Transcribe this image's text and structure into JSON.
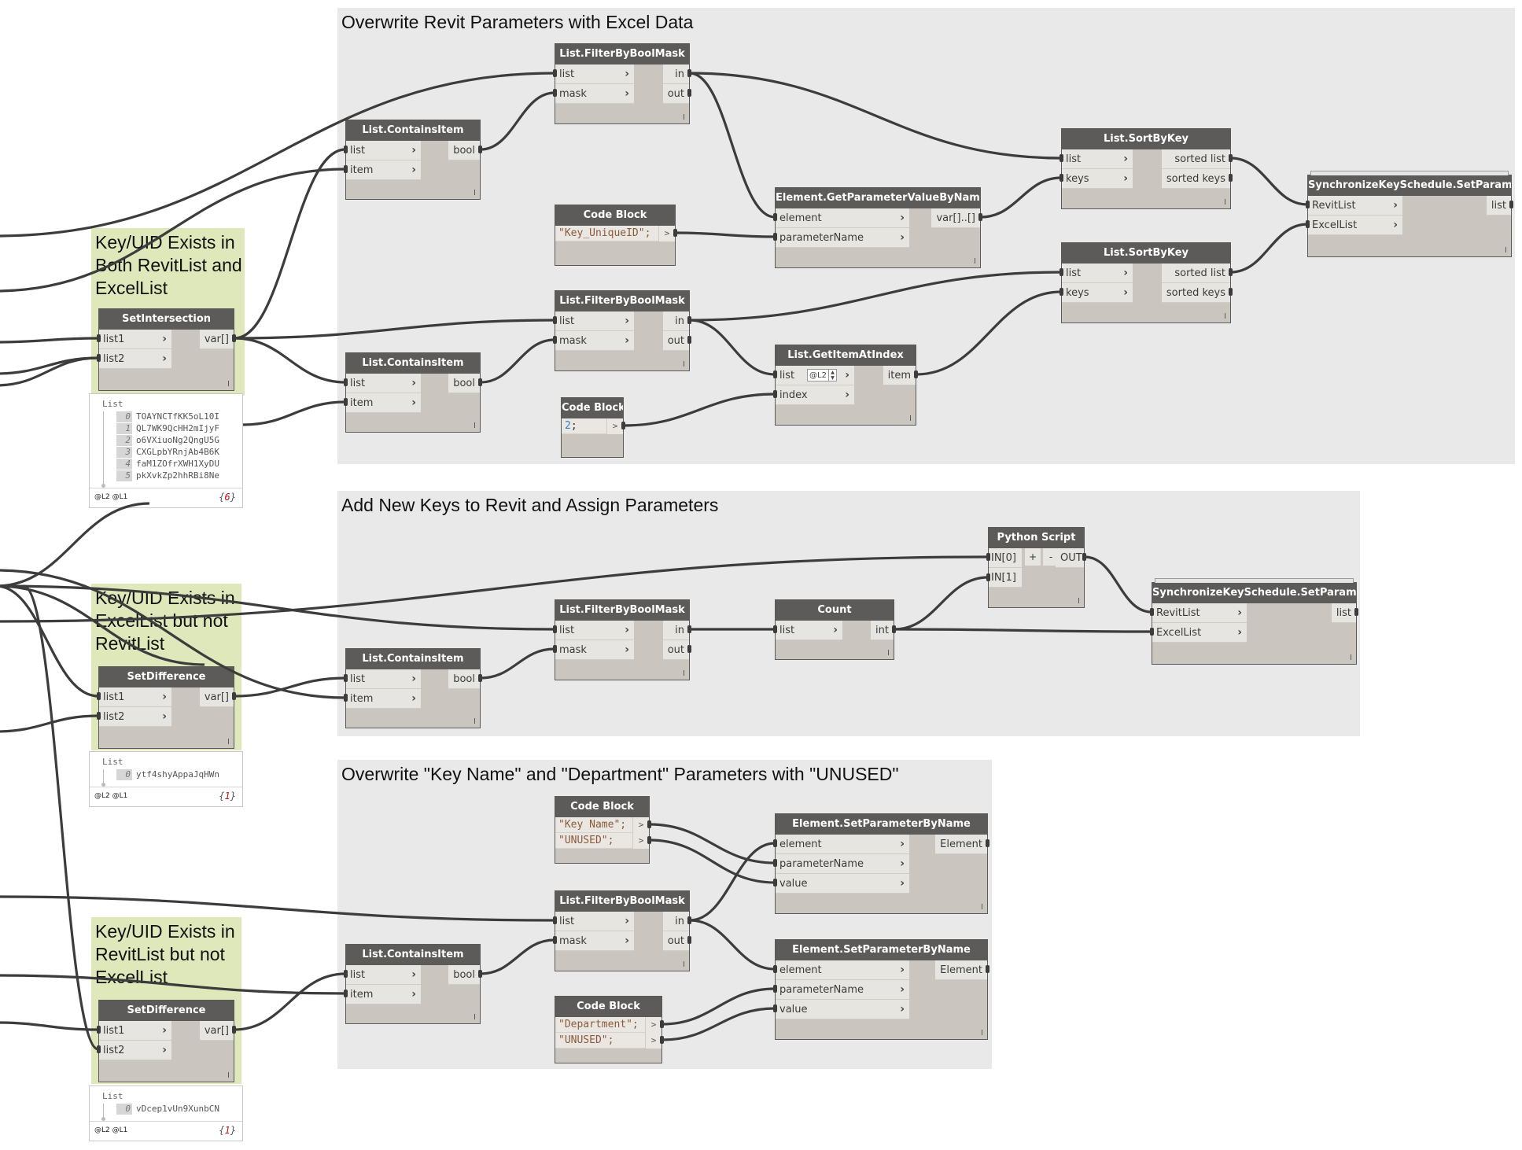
{
  "groups": [
    {
      "id": "g1",
      "title": "Overwrite Revit Parameters with Excel Data"
    },
    {
      "id": "g2",
      "title": "Add New Keys to Revit and Assign Parameters"
    },
    {
      "id": "g3",
      "title": "Overwrite \"Key Name\" and \"Department\" Parameters with \"UNUSED\""
    },
    {
      "id": "gA",
      "title": "Key/UID Exists in Both RevitList and ExcelList"
    },
    {
      "id": "gB",
      "title": "Key/UID Exists in ExcelList but not RevitList"
    },
    {
      "id": "gC",
      "title": "Key/UID Exists in RevitList but not ExcelList"
    }
  ],
  "nodes": {
    "setIntersection": {
      "title": "SetIntersection",
      "inputs": [
        "list1",
        "list2"
      ],
      "outputs": [
        "var[]"
      ]
    },
    "setDifferenceB": {
      "title": "SetDifference",
      "inputs": [
        "list1",
        "list2"
      ],
      "outputs": [
        "var[]"
      ]
    },
    "setDifferenceC": {
      "title": "SetDifference",
      "inputs": [
        "list1",
        "list2"
      ],
      "outputs": [
        "var[]"
      ]
    },
    "g1_filter1": {
      "title": "List.FilterByBoolMask",
      "inputs": [
        "list",
        "mask"
      ],
      "outputs": [
        "in",
        "out"
      ]
    },
    "g1_contains1": {
      "title": "List.ContainsItem",
      "inputs": [
        "list",
        "item"
      ],
      "outputs": [
        "bool"
      ]
    },
    "g1_code1": {
      "title": "Code Block",
      "lines": [
        "\"Key_UniqueID\";"
      ]
    },
    "g1_getparam": {
      "title": "Element.GetParameterValueByName",
      "inputs": [
        "element",
        "parameterName"
      ],
      "outputs": [
        "var[]..[]"
      ]
    },
    "g1_sort1": {
      "title": "List.SortByKey",
      "inputs": [
        "list",
        "keys"
      ],
      "outputs": [
        "sorted list",
        "sorted keys"
      ]
    },
    "g1_sync": {
      "title": "SynchronizeKeySchedule.SetParameters",
      "inputs": [
        "RevitList",
        "ExcelList"
      ],
      "outputs": [
        "list"
      ]
    },
    "g1_filter2": {
      "title": "List.FilterByBoolMask",
      "inputs": [
        "list",
        "mask"
      ],
      "outputs": [
        "in",
        "out"
      ]
    },
    "g1_contains2": {
      "title": "List.ContainsItem",
      "inputs": [
        "list",
        "item"
      ],
      "outputs": [
        "bool"
      ]
    },
    "g1_code2": {
      "title": "Code Block",
      "lines": [
        "2;"
      ]
    },
    "g1_getitem": {
      "title": "List.GetItemAtIndex",
      "inputs": [
        "list",
        "index"
      ],
      "outputs": [
        "item"
      ],
      "level": "@L2"
    },
    "g1_sort2": {
      "title": "List.SortByKey",
      "inputs": [
        "list",
        "keys"
      ],
      "outputs": [
        "sorted list",
        "sorted keys"
      ]
    },
    "g2_python": {
      "title": "Python Script",
      "inputs": [
        "IN[0]",
        "IN[1]"
      ],
      "outputs": [
        "OUT"
      ],
      "add": "+",
      "remove": "-"
    },
    "g2_filter": {
      "title": "List.FilterByBoolMask",
      "inputs": [
        "list",
        "mask"
      ],
      "outputs": [
        "in",
        "out"
      ]
    },
    "g2_contains": {
      "title": "List.ContainsItem",
      "inputs": [
        "list",
        "item"
      ],
      "outputs": [
        "bool"
      ]
    },
    "g2_count": {
      "title": "Count",
      "inputs": [
        "list"
      ],
      "outputs": [
        "int"
      ]
    },
    "g2_sync": {
      "title": "SynchronizeKeySchedule.SetParameters",
      "inputs": [
        "RevitList",
        "ExcelList"
      ],
      "outputs": [
        "list"
      ]
    },
    "g3_code1": {
      "title": "Code Block",
      "lines": [
        "\"Key Name\";",
        "\"UNUSED\";"
      ]
    },
    "g3_setparam1": {
      "title": "Element.SetParameterByName",
      "inputs": [
        "element",
        "parameterName",
        "value"
      ],
      "outputs": [
        "Element"
      ]
    },
    "g3_filter": {
      "title": "List.FilterByBoolMask",
      "inputs": [
        "list",
        "mask"
      ],
      "outputs": [
        "in",
        "out"
      ]
    },
    "g3_contains": {
      "title": "List.ContainsItem",
      "inputs": [
        "list",
        "item"
      ],
      "outputs": [
        "bool"
      ]
    },
    "g3_setparam2": {
      "title": "Element.SetParameterByName",
      "inputs": [
        "element",
        "parameterName",
        "value"
      ],
      "outputs": [
        "Element"
      ]
    },
    "g3_code2": {
      "title": "Code Block",
      "lines": [
        "\"Department\";",
        "\"UNUSED\";"
      ]
    }
  },
  "watches": {
    "wA": {
      "title": "List",
      "items": [
        "TOAYNCTfKK5oL10I",
        "QL7WK9QcHH2mIjyF",
        "o6VXiuoNg2QngU5G",
        "CXGLpbYRnjAb4B6K",
        "faM1ZOfrXWH1XyDU",
        "pkXvkZp2hhRBi8Ne"
      ],
      "levels": "@L2 @L1",
      "count": "6"
    },
    "wB": {
      "title": "List",
      "items": [
        "ytf4shyAppaJqHWn"
      ],
      "levels": "@L2 @L1",
      "count": "1"
    },
    "wC": {
      "title": "List",
      "items": [
        "vDcep1vUn9XunbCN"
      ],
      "levels": "@L2 @L1",
      "count": "1"
    }
  },
  "lacing_glyph": "I",
  "port_chevron": "›",
  "code_out_glyph": ">"
}
